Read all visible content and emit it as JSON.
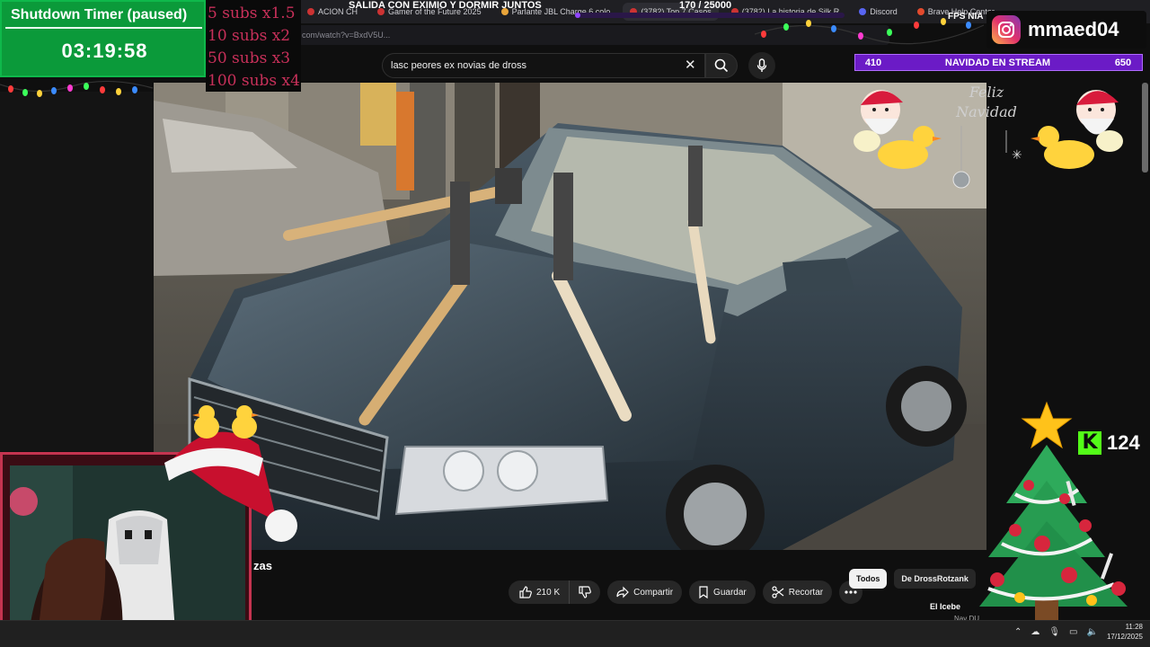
{
  "browser": {
    "tabs": [
      {
        "label": "ACION CH",
        "icon": "red-dot-icon"
      },
      {
        "label": "Gamer of the Future 2025",
        "icon": "youtube-icon"
      },
      {
        "label": "Parlante JBL Charge 6 colo",
        "icon": "store-icon"
      },
      {
        "label": "(3782) Top 7 Casos",
        "icon": "youtube-icon"
      },
      {
        "label": "(3782) La historia de Silk R",
        "icon": "youtube-icon"
      },
      {
        "label": "Discord",
        "icon": "discord-icon"
      },
      {
        "label": "Brave Help Center",
        "icon": "brave-icon"
      }
    ],
    "address": "com/watch?v=BxdV5U..."
  },
  "youtube": {
    "search_query": "lasc peores ex novias de dross",
    "video_title_fragment": "zas",
    "actions": {
      "like_count": "210 K",
      "share": "Compartir",
      "save": "Guardar",
      "clip": "Recortar"
    },
    "chips": [
      "Todos",
      "De DrossRotzank"
    ],
    "reco_title": "El Icebe",
    "reco_sub": "Nav DU..."
  },
  "overlay": {
    "timer_title": "Shutdown Timer (paused)",
    "timer_value": "03:19:58",
    "subs_multipliers": [
      "5 subs x1.5",
      "10 subs x2",
      "50 subs x3",
      "100 subs x4"
    ],
    "stream_title": "SALIDA CON EXIMIO Y DORMIR JUNTOS",
    "goal_text": "170 / 25000",
    "goal_fraction": 0.0068,
    "fps_label": "FPS NIA",
    "instagram_user": "mmaed04",
    "xmas_left": "410",
    "xmas_title": "NAVIDAD EN STREAM",
    "xmas_right": "650",
    "kick_count": "124",
    "sign_lines": [
      "Feliz",
      "Navidad"
    ]
  },
  "taskbar": {
    "time": "11:28",
    "date": "17/12/2025"
  },
  "colors": {
    "timer_green": "#0b9a3a",
    "subs_pink": "#c8305a",
    "twitch_purple": "#6b1bc6",
    "kick_green": "#53fc18",
    "webcam_border": "#c43450"
  }
}
